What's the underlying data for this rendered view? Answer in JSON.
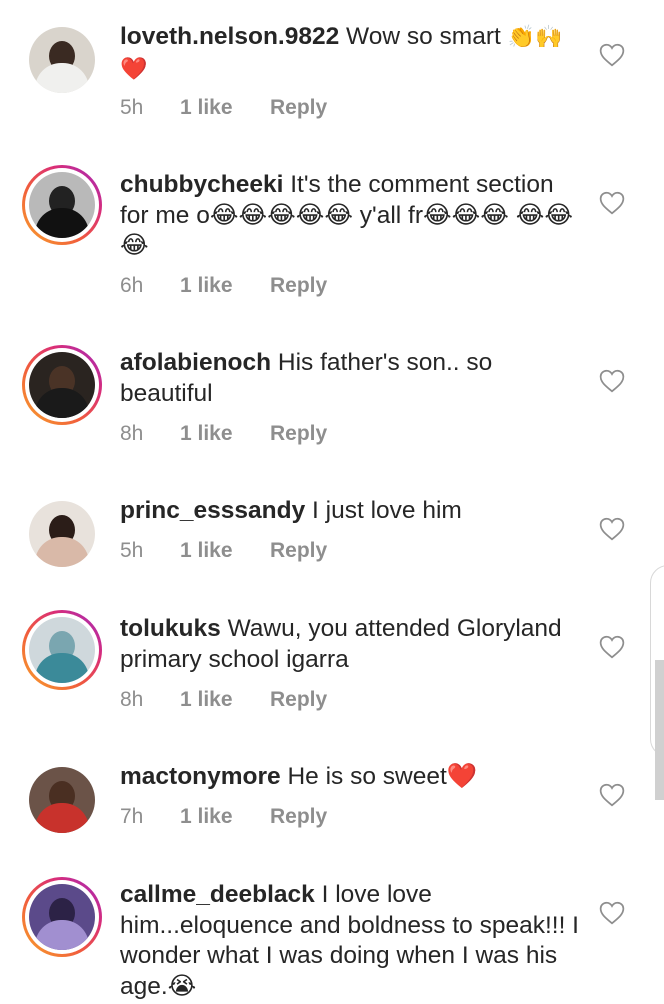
{
  "comments": [
    {
      "username": "loveth.nelson.9822",
      "text": "Wow so smart",
      "emoji": "👏🙌❤️",
      "time": "5h",
      "likes": "1 like",
      "reply": "Reply",
      "story_ring": false
    },
    {
      "username": "chubbycheeki",
      "text": "It's the comment section for me o😂😂😂😂😂 y'all fr😂😂😂 😂😂😂",
      "time": "6h",
      "likes": "1 like",
      "reply": "Reply",
      "story_ring": true
    },
    {
      "username": "afolabienoch",
      "text": "His father's son.. so beautiful",
      "time": "8h",
      "likes": "1 like",
      "reply": "Reply",
      "story_ring": true
    },
    {
      "username": "princ_esssandy",
      "text": "I just love him",
      "time": "5h",
      "likes": "1 like",
      "reply": "Reply",
      "story_ring": false
    },
    {
      "username": "tolukuks",
      "text": "Wawu, you attended Gloryland primary school igarra",
      "time": "8h",
      "likes": "1 like",
      "reply": "Reply",
      "story_ring": true
    },
    {
      "username": "mactonymore",
      "text": "He is so sweet❤️",
      "time": "7h",
      "likes": "1 like",
      "reply": "Reply",
      "story_ring": false
    },
    {
      "username": "callme_deeblack",
      "text": "I love love him...eloquence and boldness to speak!!! I wonder what I was doing when I was his age.😭",
      "time": "",
      "likes": "",
      "reply": "",
      "story_ring": true
    }
  ],
  "icons": {
    "like": "heart-outline-icon"
  },
  "colors": {
    "text": "#262626",
    "meta": "#8e8e8e",
    "story_ring": [
      "#f9a52a",
      "#d92d78",
      "#9b2bc4"
    ]
  }
}
